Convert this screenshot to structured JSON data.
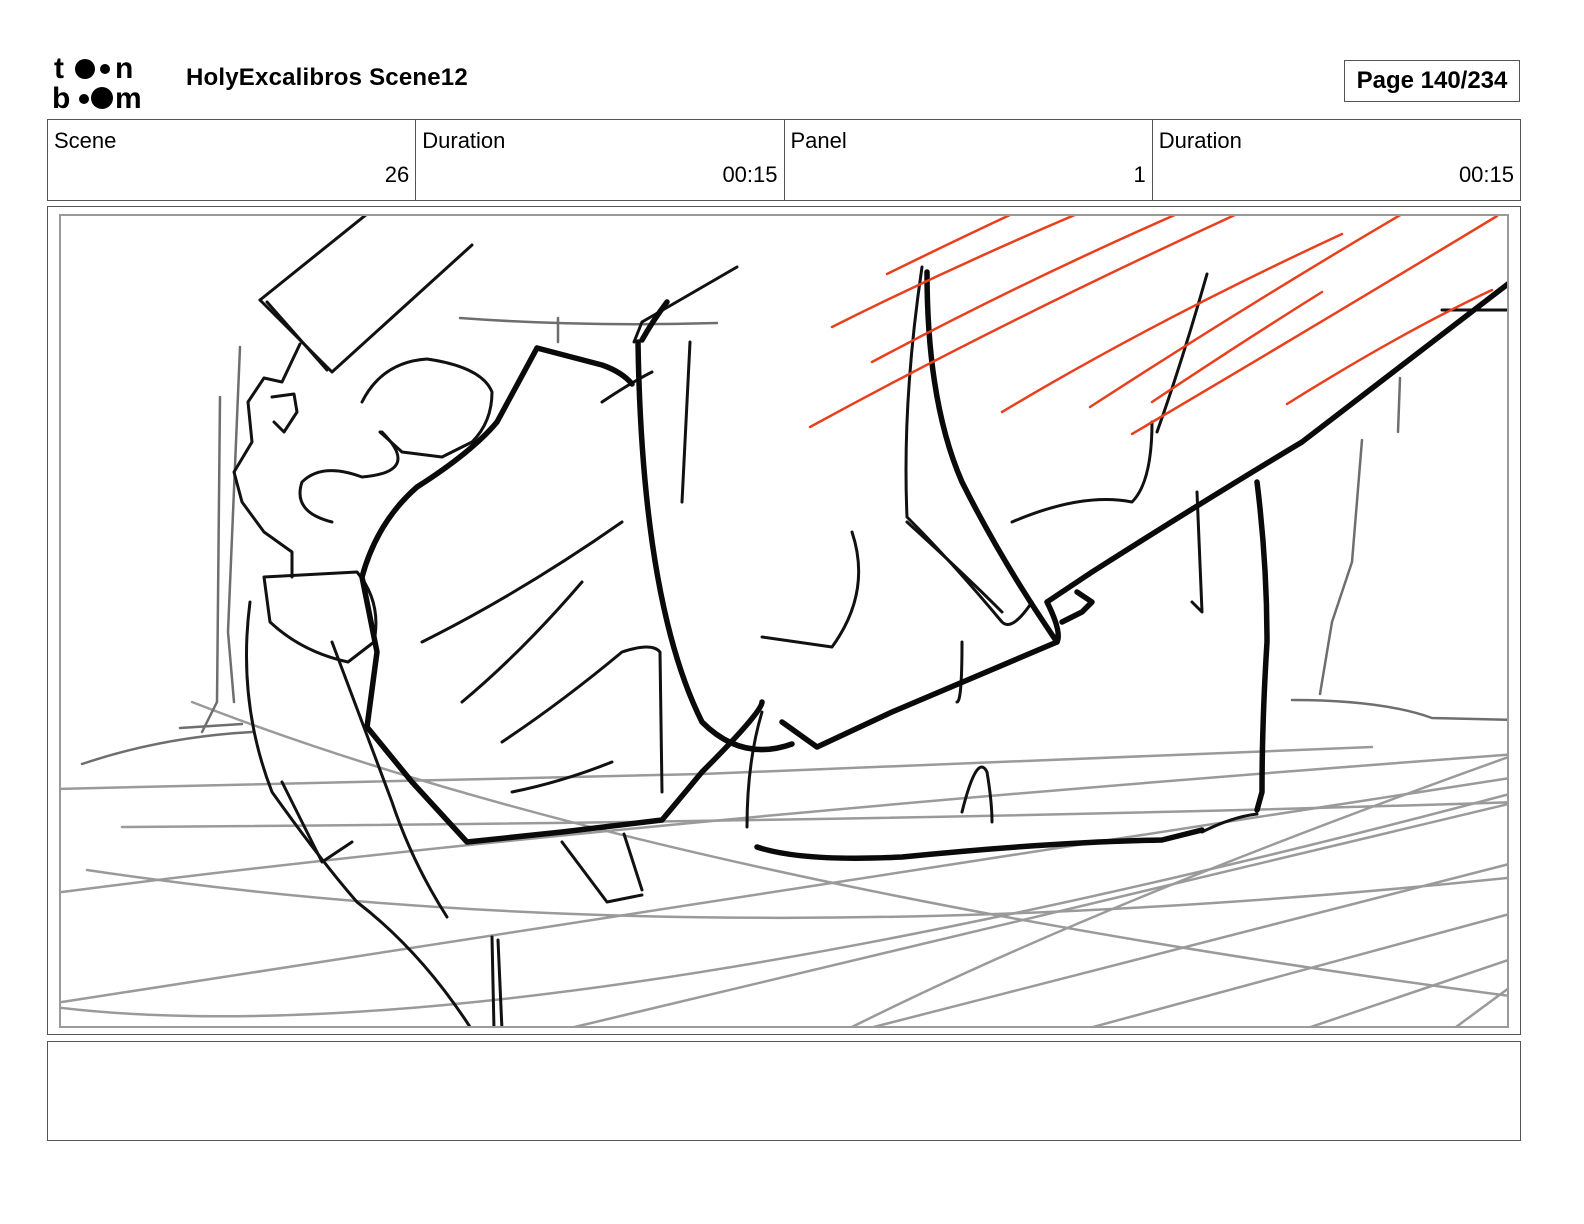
{
  "header": {
    "logo_text": "toon boom",
    "project_title": "HolyExcalibros Scene12",
    "page_indicator": "Page 140/234"
  },
  "info_table": {
    "scene_label": "Scene",
    "scene_value": "26",
    "scene_duration_label": "Duration",
    "scene_duration_value": "00:15",
    "panel_label": "Panel",
    "panel_value": "1",
    "panel_duration_label": "Duration",
    "panel_duration_value": "00:15"
  },
  "panel": {
    "sketch_subject": "storyboard-sketch",
    "accent_color": "#e8401c"
  },
  "notes": {
    "text": ""
  }
}
